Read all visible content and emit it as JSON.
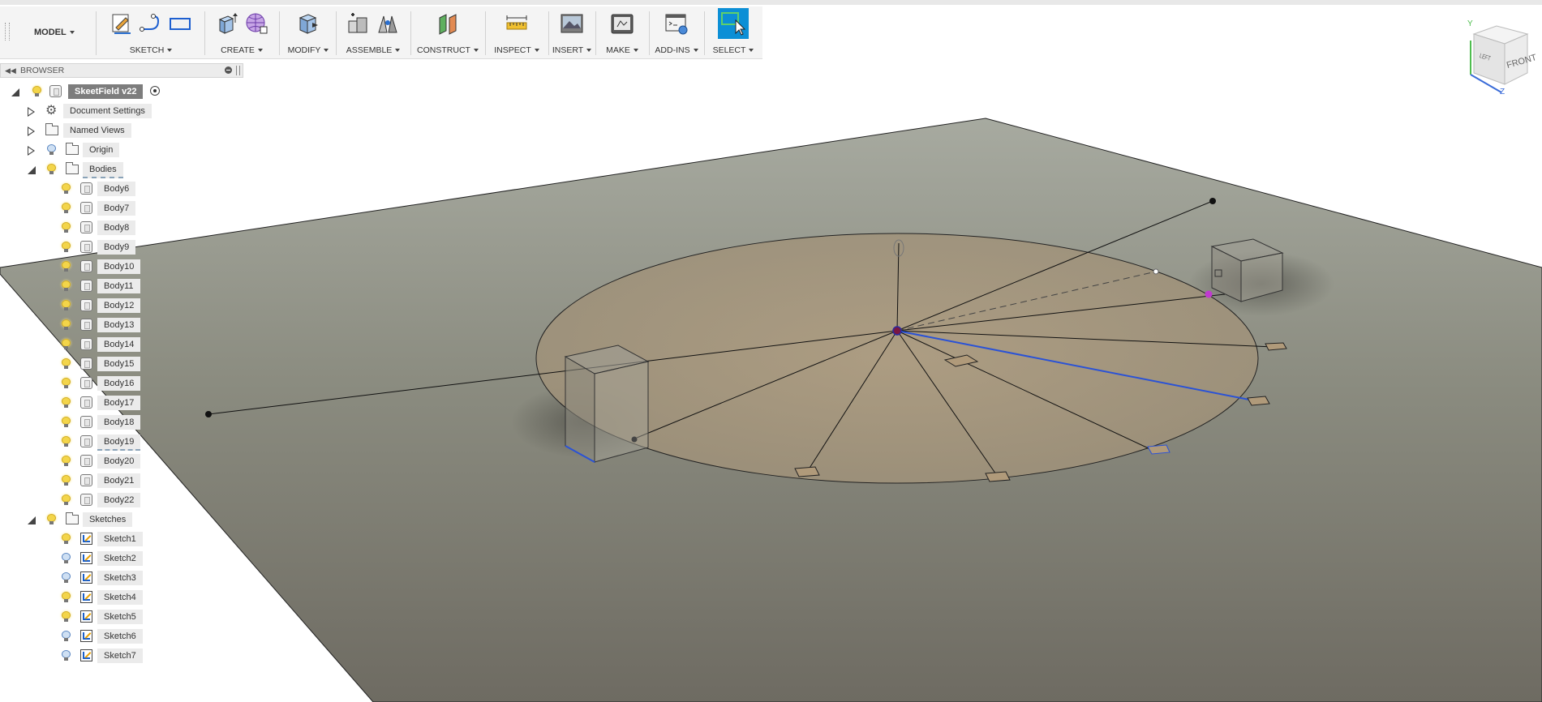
{
  "toolbar": {
    "workspace": "MODEL",
    "groups": [
      {
        "label": "SKETCH",
        "icons": [
          "create-sketch-icon",
          "line-arc-icon",
          "rectangle-icon"
        ]
      },
      {
        "label": "CREATE",
        "icons": [
          "extrude-icon",
          "form-lattice-icon"
        ]
      },
      {
        "label": "MODIFY",
        "icons": [
          "press-pull-icon"
        ]
      },
      {
        "label": "ASSEMBLE",
        "icons": [
          "new-component-icon",
          "joint-icon"
        ]
      },
      {
        "label": "CONSTRUCT",
        "icons": [
          "offset-plane-icon"
        ]
      },
      {
        "label": "INSPECT",
        "icons": [
          "measure-icon"
        ]
      },
      {
        "label": "INSERT",
        "icons": [
          "insert-image-icon"
        ]
      },
      {
        "label": "MAKE",
        "icons": [
          "print-3d-icon"
        ]
      },
      {
        "label": "ADD-INS",
        "icons": [
          "scripts-addins-icon"
        ]
      },
      {
        "label": "SELECT",
        "icons": [
          "select-cursor-icon"
        ]
      }
    ]
  },
  "browser": {
    "title": "BROWSER",
    "root": "SkeetField v22",
    "folders": {
      "document_settings": "Document Settings",
      "named_views": "Named Views",
      "origin": "Origin",
      "bodies": "Bodies",
      "sketches": "Sketches"
    },
    "bodies": [
      {
        "name": "Body6",
        "visible": true
      },
      {
        "name": "Body7",
        "visible": true
      },
      {
        "name": "Body8",
        "visible": true
      },
      {
        "name": "Body9",
        "visible": true
      },
      {
        "name": "Body10",
        "visible": true
      },
      {
        "name": "Body11",
        "visible": true
      },
      {
        "name": "Body12",
        "visible": true
      },
      {
        "name": "Body13",
        "visible": true
      },
      {
        "name": "Body14",
        "visible": true
      },
      {
        "name": "Body15",
        "visible": true
      },
      {
        "name": "Body16",
        "visible": true
      },
      {
        "name": "Body17",
        "visible": true
      },
      {
        "name": "Body18",
        "visible": true
      },
      {
        "name": "Body19",
        "visible": true
      },
      {
        "name": "Body20",
        "visible": true
      },
      {
        "name": "Body21",
        "visible": true
      },
      {
        "name": "Body22",
        "visible": true
      }
    ],
    "sketches": [
      {
        "name": "Sketch1",
        "visible": true
      },
      {
        "name": "Sketch2",
        "visible": false
      },
      {
        "name": "Sketch3",
        "visible": false
      },
      {
        "name": "Sketch4",
        "visible": true
      },
      {
        "name": "Sketch5",
        "visible": true
      },
      {
        "name": "Sketch6",
        "visible": false
      },
      {
        "name": "Sketch7",
        "visible": false
      }
    ]
  },
  "viewcube": {
    "front": "FRONT",
    "left": "LEFT",
    "axis_y": "Y",
    "axis_z": "Z"
  },
  "colors": {
    "ground_plane": "#8a8a7e",
    "circle_fill": "#a79a80",
    "sketch_line": "#111111",
    "selected_line": "#2a52d6",
    "select_button": "#0c8fd6"
  }
}
